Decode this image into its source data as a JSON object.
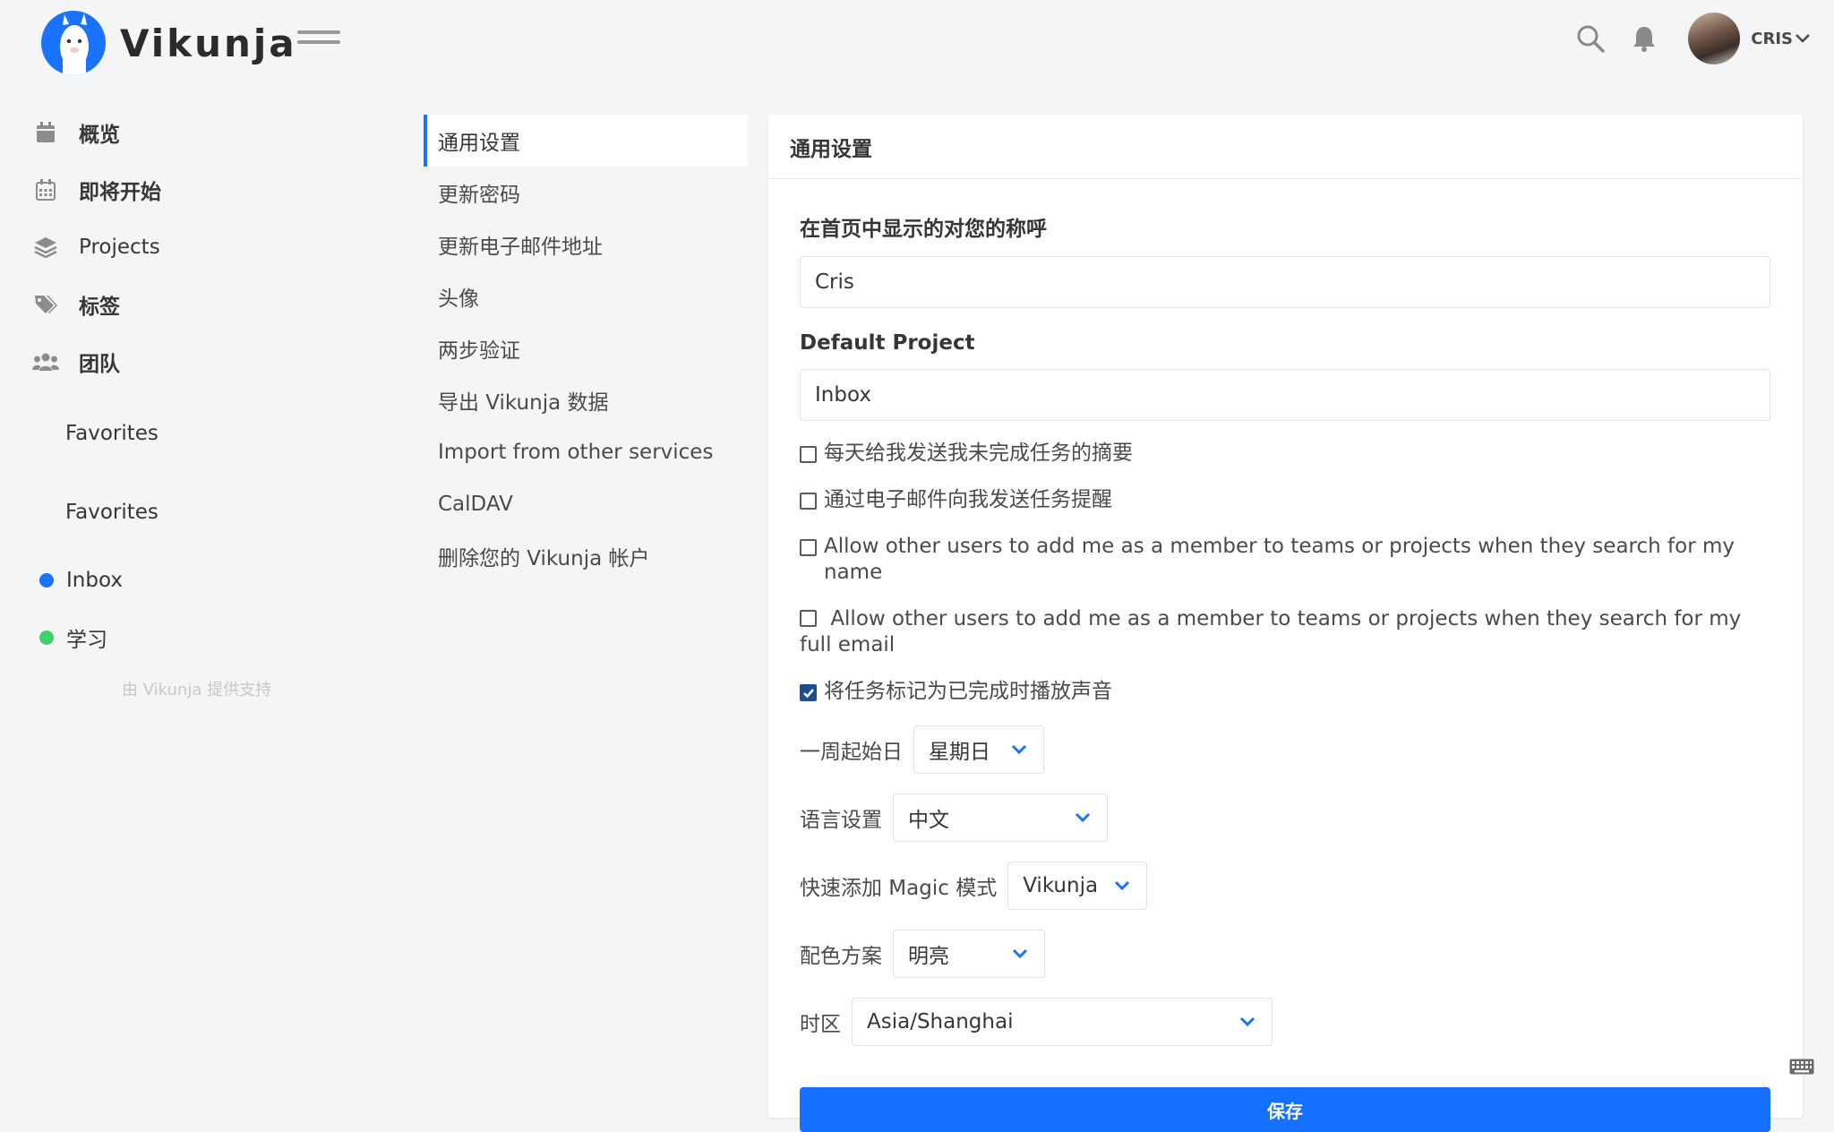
{
  "app": {
    "name": "Vikunja"
  },
  "header": {
    "user_name": "CRIS"
  },
  "sidebar": {
    "items": [
      {
        "label": "概览",
        "icon": "calendar-icon"
      },
      {
        "label": "即将开始",
        "icon": "calendar-grid-icon"
      },
      {
        "label": "Projects",
        "icon": "layers-icon"
      },
      {
        "label": "标签",
        "icon": "tags-icon"
      },
      {
        "label": "团队",
        "icon": "users-icon"
      }
    ],
    "favorites": [
      "Favorites",
      "Favorites"
    ],
    "projects": [
      {
        "label": "Inbox",
        "color": "#1973ff"
      },
      {
        "label": "学习",
        "color": "#3fd16a"
      }
    ],
    "powered_by": "由 Vikunja 提供支持"
  },
  "settings_nav": {
    "items": [
      "通用设置",
      "更新密码",
      "更新电子邮件地址",
      "头像",
      "两步验证",
      "导出 Vikunja 数据",
      "Import from other services",
      "CalDAV",
      "删除您的 Vikunja 帐户"
    ]
  },
  "general": {
    "title": "通用设置",
    "name_label": "在首页中显示的对您的称呼",
    "name_value": "Cris",
    "default_project_label": "Default Project",
    "default_project_value": "Inbox",
    "checkboxes": [
      {
        "label": "每天给我发送我未完成任务的摘要",
        "checked": false
      },
      {
        "label": "通过电子邮件向我发送任务提醒",
        "checked": false
      },
      {
        "label": "Allow other users to add me as a member to teams or projects when they search for my name",
        "checked": false
      },
      {
        "label": "Allow other users to add me as a member to teams or projects when they search for my full email",
        "checked": false
      },
      {
        "label": "将任务标记为已完成时播放声音",
        "checked": true
      }
    ],
    "week_start_label": "一周起始日",
    "week_start_value": "星期日",
    "language_label": "语言设置",
    "language_value": "中文",
    "quick_add_label": "快速添加 Magic 模式",
    "quick_add_value": "Vikunja",
    "color_scheme_label": "配色方案",
    "color_scheme_value": "明亮",
    "timezone_label": "时区",
    "timezone_value": "Asia/Shanghai",
    "save_label": "保存"
  },
  "colors": {
    "accent": "#1973ff",
    "save_button": "#1570ff",
    "checked": "#1f4e8c"
  }
}
